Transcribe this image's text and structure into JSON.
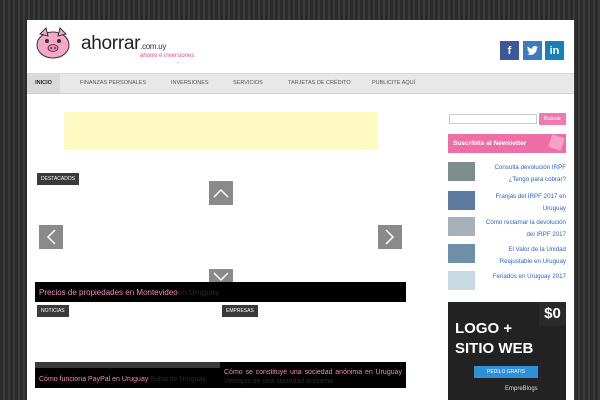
{
  "header": {
    "logo_text": "ahorrar",
    "logo_domain": ".com.uy",
    "logo_tagline": "ahorro e inversiones",
    "logo_dash": "-",
    "social": [
      "f",
      "t",
      "in"
    ]
  },
  "nav": {
    "items": [
      "INICIO",
      "FINANZAS PERSONALES",
      "INVERSIONES",
      "SERVICIOS",
      "TARJETAS DE CRÉDITO",
      "PUBLICITE AQUÍ"
    ]
  },
  "slider": {
    "destacados_label": "DESTACADOS",
    "caption": "Precios de propiedades en Montevideo",
    "caption_ghost": "en Uruguay"
  },
  "news": {
    "noticias_label": "NOTICIAS",
    "empresas_label": "EMPRESAS",
    "item1": "Cómo funciona PayPal en Uruguay",
    "item1_ghost": "Bolsa de Uruguay",
    "item2": "Cómo se constituye una sociedad anónima en Uruguay",
    "item2_ghost": "Ventajas de una sociedad anónima"
  },
  "sidebar": {
    "search_button": "Buscar",
    "search_placeholder": "",
    "newsletter": "Suscribite al Newsletter",
    "posts": [
      {
        "title": "Consulta devolución IRPF ¿Tengo para cobrar?",
        "color": "#7f8c8d"
      },
      {
        "title": "Franjas del IRPF 2017 en Uruguay",
        "color": "#5a7aa0"
      },
      {
        "title": "Cómo reclamar la devolución del IRPF 2017",
        "color": "#a8b0b8"
      },
      {
        "title": "El Valor de la Unidad Reajustable en Uruguay",
        "color": "#6e8fa8"
      },
      {
        "title": "Feriados en Uruguay 2017",
        "color": "#c9d9e4"
      }
    ],
    "ad": {
      "logo": "LOGO +",
      "logo2": "SITIO WEB",
      "price": "$0",
      "button": "PEDILO GRATIS",
      "brand": "EmpreBlogs"
    }
  }
}
